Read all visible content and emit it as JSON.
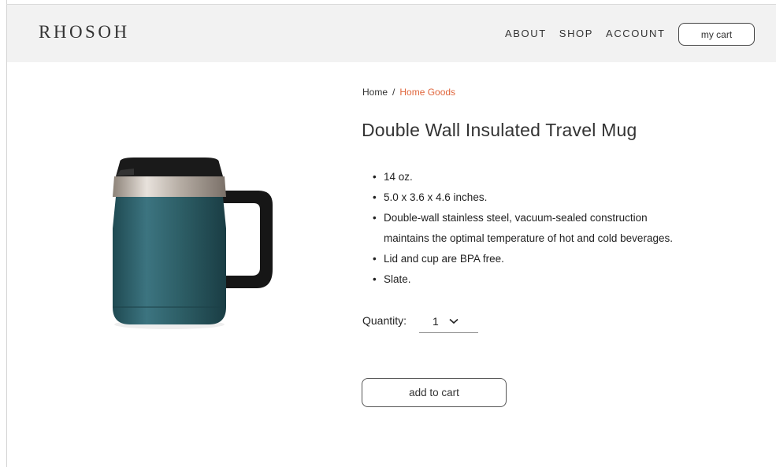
{
  "header": {
    "logo": "RHOSOH",
    "nav": [
      "ABOUT",
      "SHOP",
      "ACCOUNT"
    ],
    "cart_label": "my cart"
  },
  "breadcrumb": {
    "home": "Home",
    "separator": "/",
    "current": "Home Goods"
  },
  "product": {
    "title": "Double Wall Insulated Travel Mug",
    "features": [
      "14 oz.",
      "5.0 x 3.6 x 4.6 inches.",
      "Double-wall stainless steel, vacuum-sealed construction",
      "maintains the optimal temperature of hot and cold beverages.",
      "Lid and cup are BPA free.",
      "Slate."
    ],
    "quantity_label": "Quantity:",
    "quantity_value": "1",
    "add_to_cart_label": "add to cart"
  },
  "colors": {
    "header_bg": "#f2f2f2",
    "accent": "#e0663c",
    "mug_body": "#2d5e66"
  }
}
